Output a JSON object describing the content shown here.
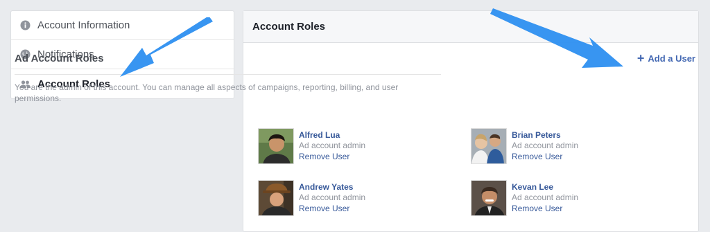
{
  "sidebar": {
    "items": [
      {
        "label": "Account Information",
        "icon": "info-icon"
      },
      {
        "label": "Notifications",
        "icon": "globe-icon"
      },
      {
        "label": "Account Roles",
        "icon": "people-icon"
      }
    ]
  },
  "main": {
    "header_title": "Account Roles",
    "section_title": "Ad Account Roles",
    "add_user_label": "Add a User",
    "description": "You are the admin of this account. You can manage all aspects of campaigns, reporting, billing, and user permissions.",
    "users": [
      {
        "name": "Alfred Lua",
        "role": "Ad account admin",
        "remove": "Remove User"
      },
      {
        "name": "Brian Peters",
        "role": "Ad account admin",
        "remove": "Remove User"
      },
      {
        "name": "Andrew Yates",
        "role": "Ad account admin",
        "remove": "Remove User"
      },
      {
        "name": "Kevan Lee",
        "role": "Ad account admin",
        "remove": "Remove User"
      }
    ]
  },
  "colors": {
    "link": "#365899",
    "accent": "#4267b2",
    "arrow": "#2d8ff0",
    "background": "#e9ebee"
  }
}
